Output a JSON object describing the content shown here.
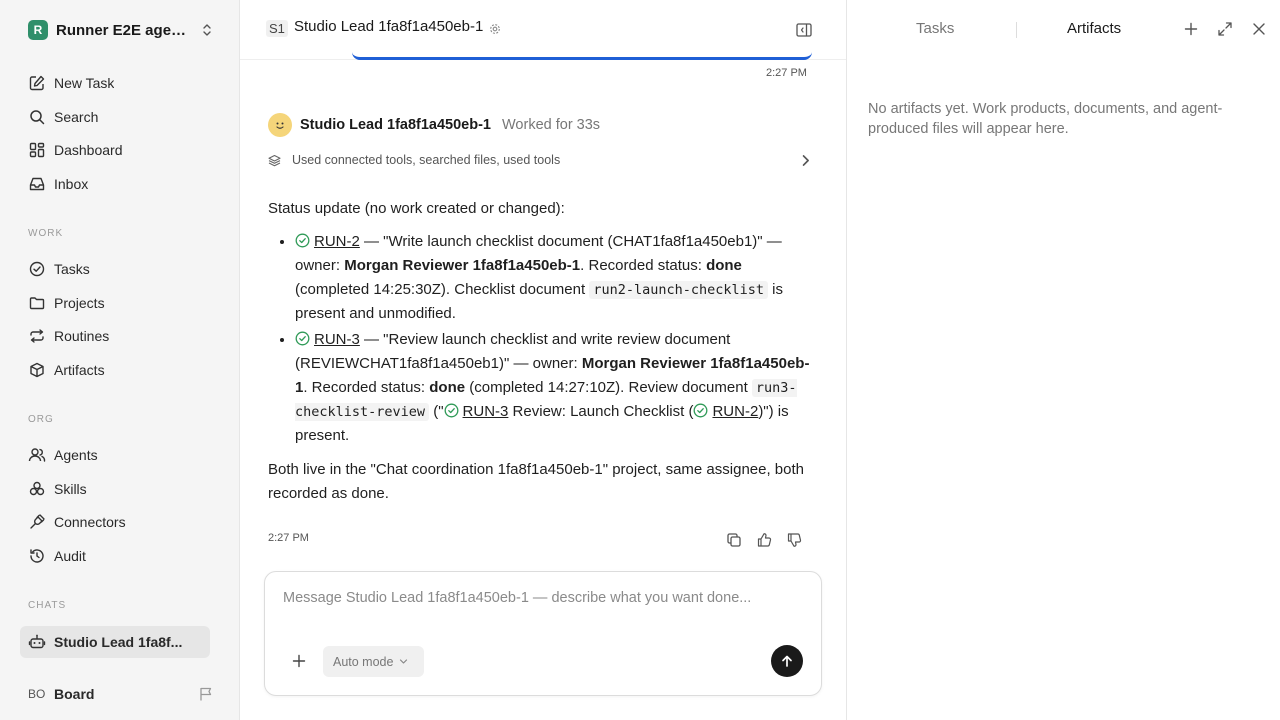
{
  "sidebar": {
    "workspace": {
      "logo": "R",
      "name": "Runner E2E agen..."
    },
    "nav": [
      {
        "label": "New Task",
        "icon": "new-task-icon"
      },
      {
        "label": "Search",
        "icon": "search-icon"
      },
      {
        "label": "Dashboard",
        "icon": "dashboard-icon"
      },
      {
        "label": "Inbox",
        "icon": "inbox-icon"
      }
    ],
    "work_section": "WORK",
    "work": [
      {
        "label": "Tasks",
        "icon": "check-circle-icon"
      },
      {
        "label": "Projects",
        "icon": "folder-icon"
      },
      {
        "label": "Routines",
        "icon": "repeat-icon"
      },
      {
        "label": "Artifacts",
        "icon": "box-icon"
      }
    ],
    "org_section": "ORG",
    "org": [
      {
        "label": "Agents",
        "icon": "users-icon"
      },
      {
        "label": "Skills",
        "icon": "skills-icon"
      },
      {
        "label": "Connectors",
        "icon": "plug-icon"
      },
      {
        "label": "Audit",
        "icon": "history-icon"
      }
    ],
    "chats_section": "CHATS",
    "chats": [
      {
        "label": "Studio Lead 1fa8f...",
        "icon": "bot-icon"
      }
    ],
    "board": {
      "initials": "BO",
      "label": "Board"
    }
  },
  "header": {
    "badge": "S1",
    "title": "Studio Lead 1fa8f1a450eb-1"
  },
  "messages": {
    "prev_time": "2:27 PM",
    "agent_name": "Studio Lead 1fa8f1a450eb-1",
    "worked": "Worked for 33s",
    "tools_summary": "Used connected tools, searched files, used tools",
    "intro": "Status update (no work created or changed):",
    "items": [
      {
        "link": "RUN-2",
        "t1": " — \"Write launch checklist document (CHAT1fa8f1a450eb1)\" — owner: ",
        "owner": "Morgan Reviewer 1fa8f1a450eb-1",
        "t2": ". Recorded status: ",
        "status": "done",
        "t3": " (completed 14:25:30Z). Checklist document ",
        "code": "run2-launch-checklist",
        "t4": " is present and unmodified."
      },
      {
        "link": "RUN-3",
        "t1": " — \"Review launch checklist and write review document (REVIEWCHAT1fa8f1a450eb1)\" — owner: ",
        "owner": "Morgan Reviewer 1fa8f1a450eb-1",
        "t2": ". Recorded status: ",
        "status": "done",
        "t3": " (completed 14:27:10Z). Review document ",
        "code": "run3-checklist-review",
        "t4a": " (\"",
        "link2": "RUN-3",
        "t4b": " Review: Launch Checklist (",
        "link3": "RUN-2",
        "t4c": ")\") is present."
      }
    ],
    "outro": "Both live in the \"Chat coordination 1fa8f1a450eb-1\" project, same assignee, both recorded as done.",
    "time": "2:27 PM"
  },
  "composer": {
    "placeholder": "Message Studio Lead 1fa8f1a450eb-1 — describe what you want done...",
    "mode": "Auto mode"
  },
  "right_panel": {
    "tabs": [
      "Tasks",
      "Artifacts"
    ],
    "empty_text": "No artifacts yet. Work products, documents, and agent-produced files will appear here."
  },
  "colors": {
    "accent_blue": "#1f5fd6",
    "check_green": "#2f9a57",
    "logo_green": "#2f8f6a"
  }
}
